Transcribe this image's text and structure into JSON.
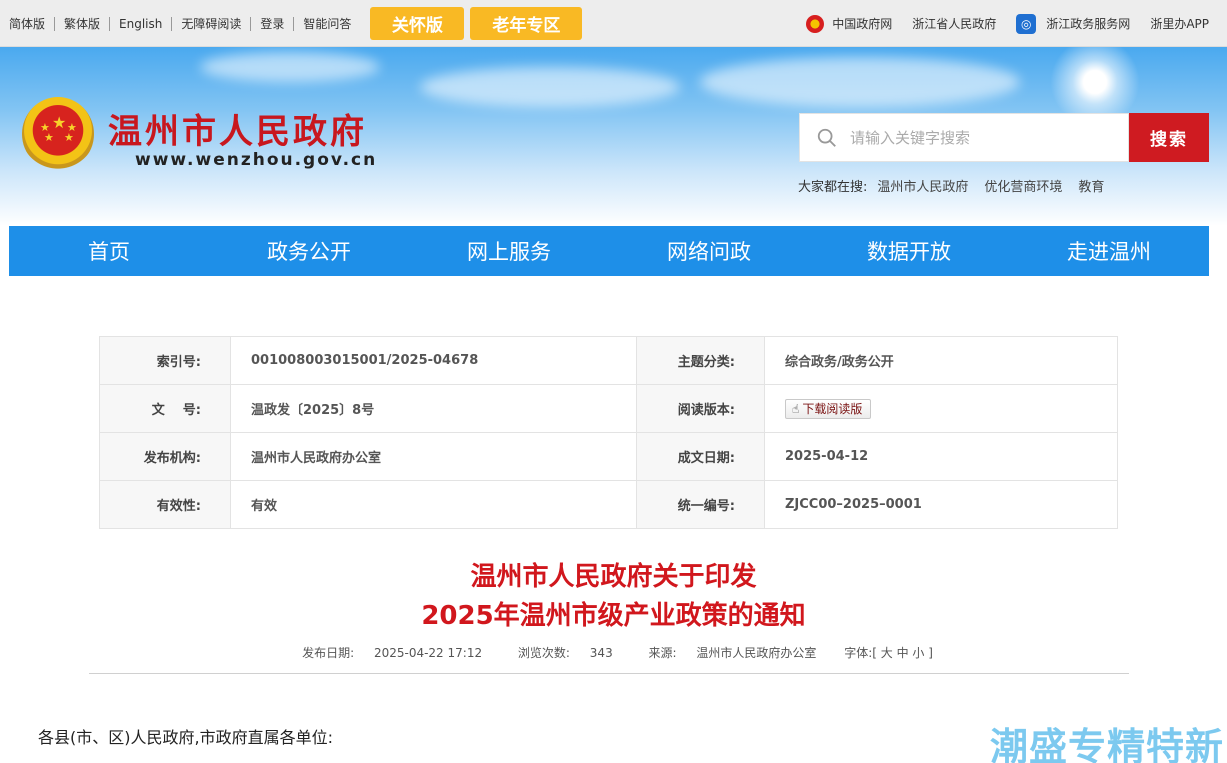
{
  "topbar": {
    "links": [
      "简体版",
      "繁体版",
      "English",
      "无障碍阅读",
      "登录",
      "智能问答"
    ],
    "care_button": "关怀版",
    "elder_button": "老年专区",
    "right_links": [
      "中国政府网",
      "浙江省人民政府",
      "浙江政务服务网",
      "浙里办APP"
    ]
  },
  "header": {
    "site_name": "温州市人民政府",
    "site_url": "www.wenzhou.gov.cn",
    "search_placeholder": "请输入关键字搜索",
    "search_button": "搜索",
    "hot_label": "大家都在搜:",
    "hot_keywords": [
      "温州市人民政府",
      "优化营商环境",
      "教育"
    ]
  },
  "nav": [
    "首页",
    "政务公开",
    "网上服务",
    "网络问政",
    "数据开放",
    "走进温州"
  ],
  "meta": {
    "rows": [
      {
        "k1": "索引号:",
        "v1": "001008003015001/2025-04678",
        "k2": "主题分类:",
        "v2": "综合政务/政务公开"
      },
      {
        "k1": "文    号:",
        "v1": "温政发〔2025〕8号",
        "k2": "阅读版本:",
        "v2": "下载阅读版"
      },
      {
        "k1": "发布机构:",
        "v1": "温州市人民政府办公室",
        "k2": "成文日期:",
        "v2": "2025-04-12"
      },
      {
        "k1": "有效性:",
        "v1": "有效",
        "k2": "统一编号:",
        "v2": "ZJCC00–2025–0001"
      }
    ]
  },
  "article": {
    "title_line1": "温州市人民政府关于印发",
    "title_line2": "2025年温州市级产业政策的通知",
    "publish_label": "发布日期:",
    "publish_date": "2025-04-22 17:12",
    "views_label": "浏览次数:",
    "views": "343",
    "source_label": "来源:",
    "source": "温州市人民政府办公室",
    "font_label": "字体:[ 大 中 小 ]",
    "salutation": "各县(市、区)人民政府,市政府直属各单位:"
  },
  "watermark": "潮盛专精特新",
  "colors": {
    "brand_red": "#cf1b21",
    "nav_blue": "#1e8fe8",
    "care_yellow": "#f9b924"
  }
}
